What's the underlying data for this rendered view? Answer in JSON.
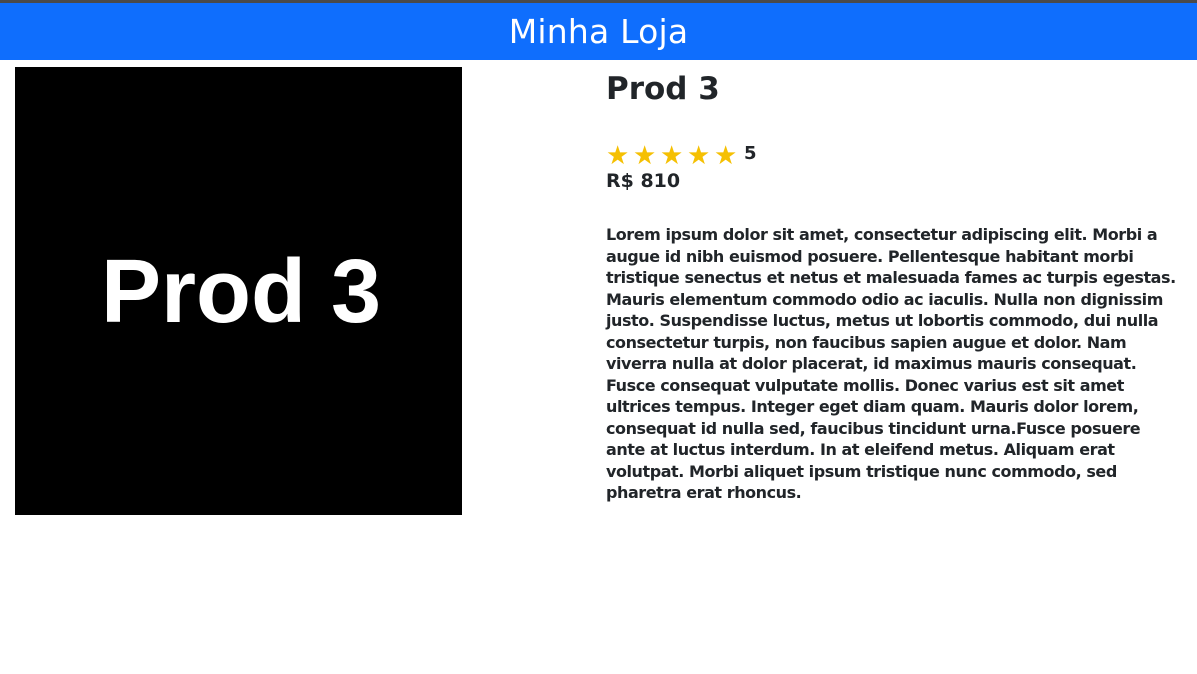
{
  "header": {
    "brand": "Minha Loja",
    "color": "#0f6efd"
  },
  "product": {
    "image_text": "Prod 3",
    "title": "Prod 3",
    "rating": {
      "stars": 5,
      "max": 5,
      "value_label": "5",
      "star_color": "#f5c003",
      "icon": "star-icon"
    },
    "price": "R$ 810",
    "description": "Lorem ipsum dolor sit amet, consectetur adipiscing elit. Morbi a augue id nibh euismod posuere. Pellentesque habitant morbi tristique senectus et netus et malesuada fames ac turpis egestas. Mauris elementum commodo odio ac iaculis. Nulla non dignissim justo. Suspendisse luctus, metus ut lobortis commodo, dui nulla consectetur turpis, non faucibus sapien augue et dolor. Nam viverra nulla at dolor placerat, id maximus mauris consequat. Fusce consequat vulputate mollis. Donec varius est sit amet ultrices tempus. Integer eget diam quam. Mauris dolor lorem, consequat id nulla sed, faucibus tincidunt urna.Fusce posuere ante at luctus interdum. In at eleifend metus. Aliquam erat volutpat. Morbi aliquet ipsum tristique nunc commodo, sed pharetra erat rhoncus."
  }
}
